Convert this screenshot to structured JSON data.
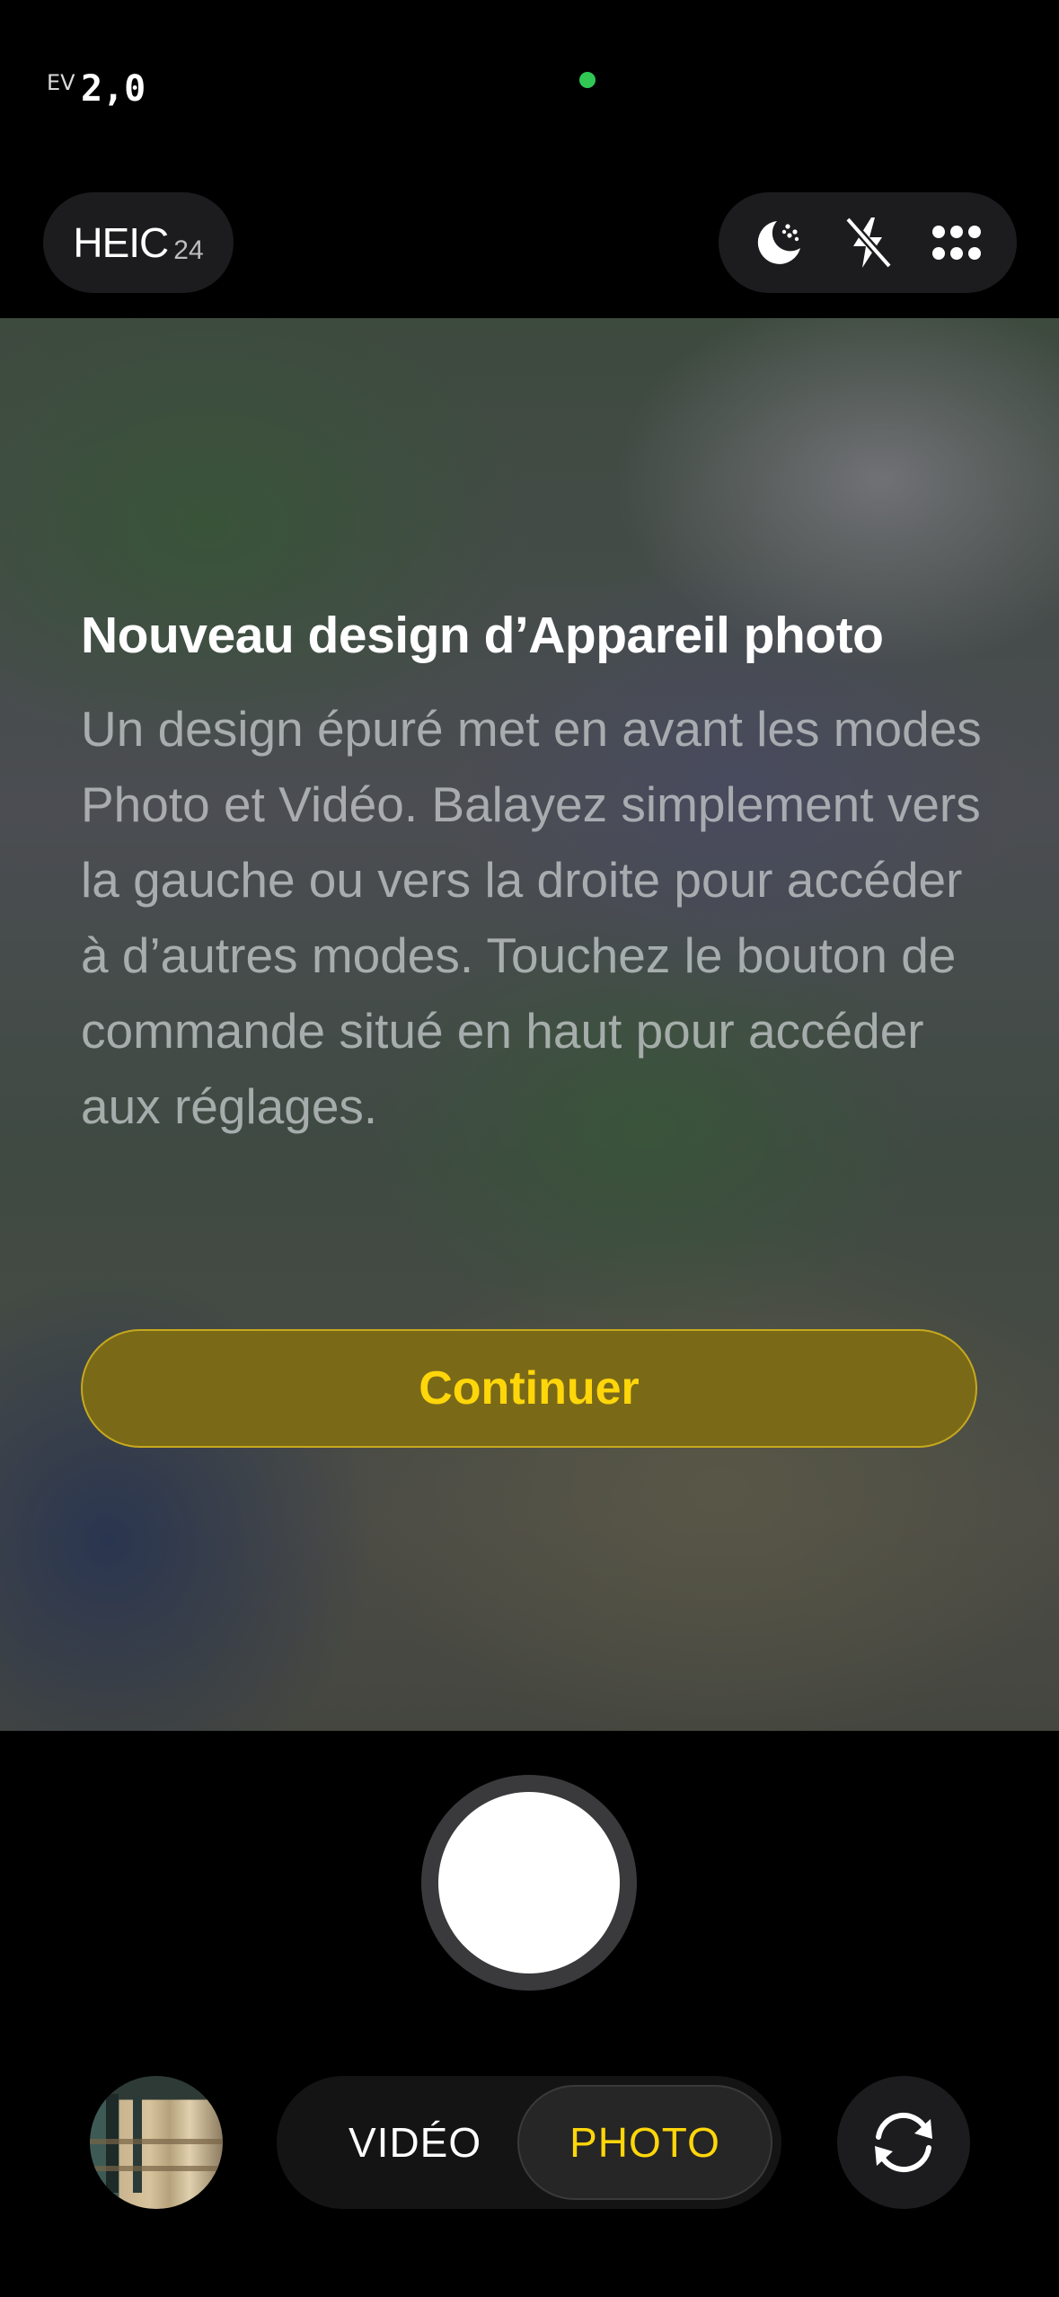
{
  "status": {
    "ev_label": "EV",
    "ev_value": "2,0"
  },
  "top_controls": {
    "format_main": "HEIC",
    "format_sub": "24",
    "icons": [
      "night-mode-icon",
      "flash-off-icon",
      "more-controls-icon"
    ]
  },
  "onboarding": {
    "title": "Nouveau design d’Appareil photo",
    "body": "Un design épuré met en avant les modes Photo et Vidéo. Balayez simplement vers la gauche ou vers la droite pour accéder à d’autres modes. Touchez le bouton de commande situé en haut pour accéder aux réglages.",
    "continue_label": "Continuer"
  },
  "modes": {
    "video_label": "VIDÉO",
    "photo_label": "PHOTO",
    "selected": "PHOTO"
  },
  "colors": {
    "accent": "#ffd60a",
    "privacy_indicator": "#30c755",
    "button_fill": "#7a6a18"
  }
}
